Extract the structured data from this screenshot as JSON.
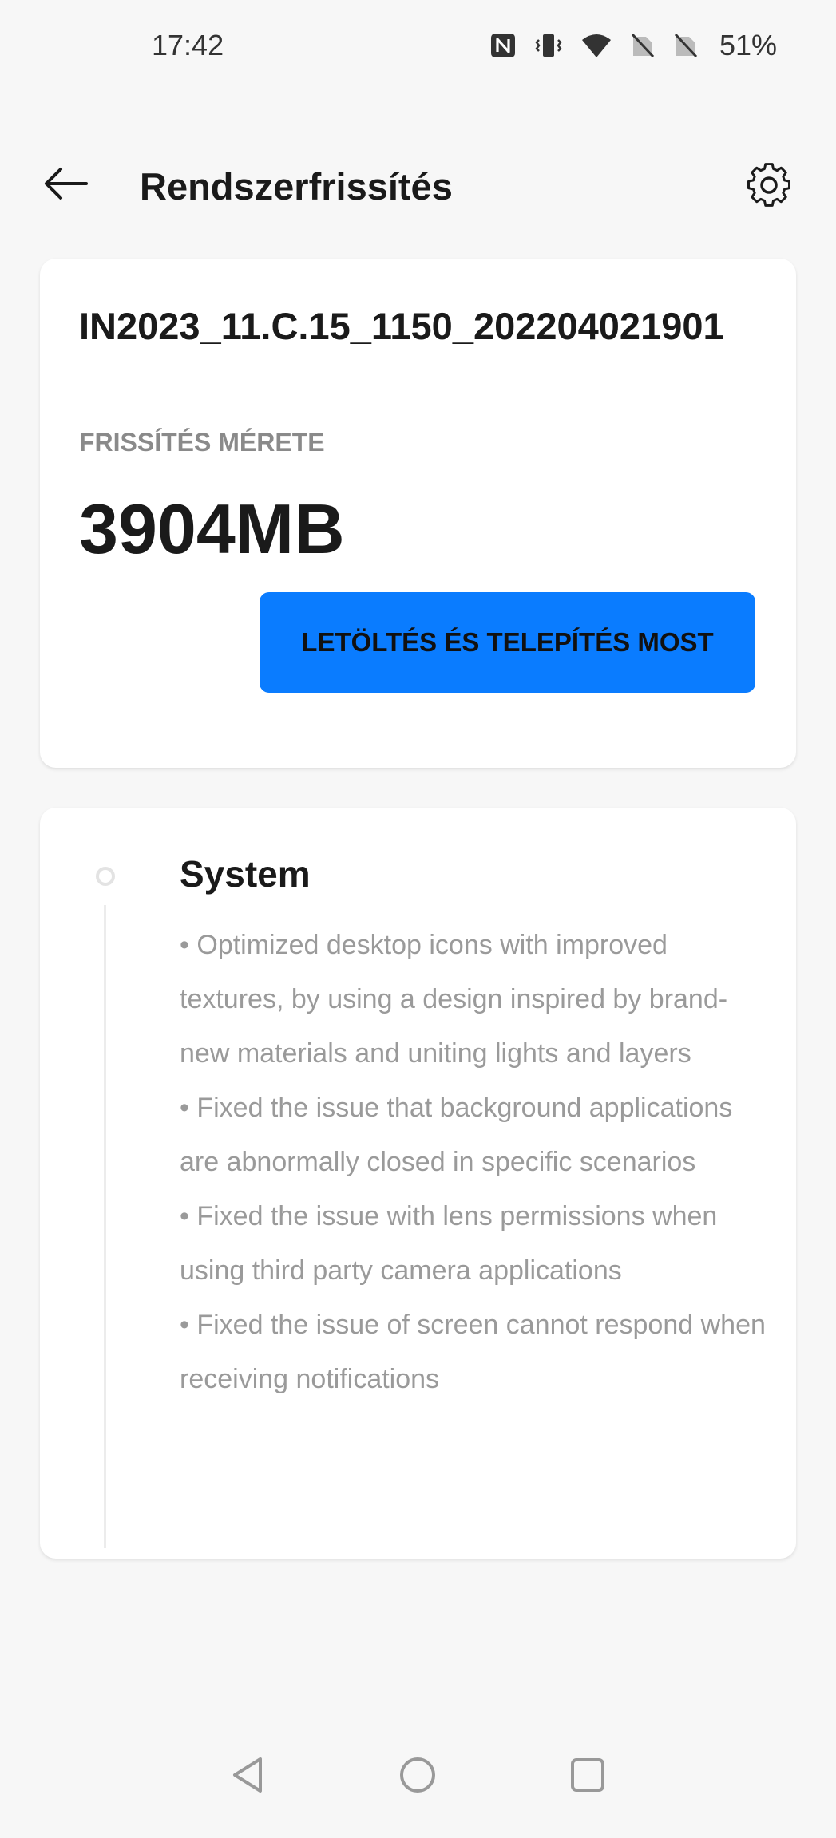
{
  "status_bar": {
    "time": "17:42",
    "battery": "51%",
    "icons": [
      "nfc-icon",
      "vibrate-icon",
      "wifi-icon",
      "no-sim-icon",
      "no-sim-icon"
    ]
  },
  "app_bar": {
    "title": "Rendszerfrissítés",
    "back_icon": "arrow-back-icon",
    "settings_icon": "gear-icon"
  },
  "update": {
    "version": "IN2023_11.C.15_1150_202204021901",
    "size_label": "FRISSÍTÉS MÉRETE",
    "size_value": "3904MB",
    "download_label": "LETÖLTÉS ÉS TELEPÍTÉS MOST",
    "accent_color": "#0a7cff"
  },
  "release_notes": {
    "section_title": "System",
    "items": [
      "• Optimized desktop icons with improved textures, by using a design inspired by brand-new materials and uniting lights and layers",
      "• Fixed the issue that background applications are abnormally closed in specific scenarios",
      "• Fixed the issue with lens permissions when using third party camera applications",
      "• Fixed the issue of screen cannot respond when receiving notifications"
    ]
  },
  "nav_bar": {
    "back_icon": "triangle-back-icon",
    "home_icon": "circle-home-icon",
    "recents_icon": "square-recents-icon"
  }
}
